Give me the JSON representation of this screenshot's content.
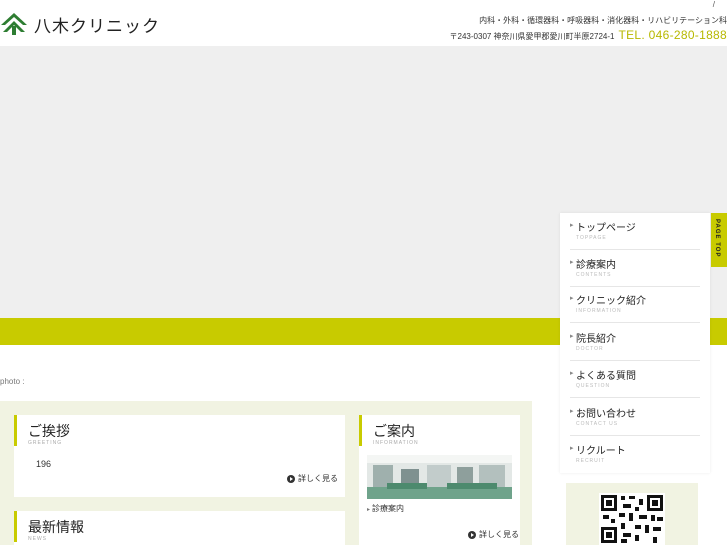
{
  "header": {
    "logo_text": "八木クリニック",
    "slash": "/",
    "specialties": "内科・外科・循環器科・呼吸器科・消化器科・リハビリテーション科",
    "address": "〒243-0307  神奈川県愛甲郡愛川町半原2724-1",
    "tel": "TEL. 046-280-1888"
  },
  "hero": {
    "photo_caption": "photo :"
  },
  "greeting": {
    "title": "ご挨拶",
    "title_en": "GREETING",
    "body": "196",
    "more": "詳しく見る"
  },
  "news": {
    "title": "最新情報",
    "title_en": "NEWS"
  },
  "information": {
    "title": "ご案内",
    "title_en": "INFORMATION",
    "link": "診療案内",
    "more": "詳しく見る"
  },
  "nav": {
    "items": [
      {
        "label": "トップページ",
        "en": "TOPPAGE"
      },
      {
        "label": "診療案内",
        "en": "CONTENTS"
      },
      {
        "label": "クリニック紹介",
        "en": "INFORMATION"
      },
      {
        "label": "院長紹介",
        "en": "DOCTOR"
      },
      {
        "label": "よくある質問",
        "en": "QUESTION"
      },
      {
        "label": "お問い合わせ",
        "en": "CONTACT US"
      },
      {
        "label": "リクルート",
        "en": "RECRUIT"
      }
    ]
  },
  "page_top": "PAGE TOP",
  "colors": {
    "accent": "#c8cb00",
    "hero_bg": "#efefef",
    "content_bg": "#f1f3e2"
  }
}
